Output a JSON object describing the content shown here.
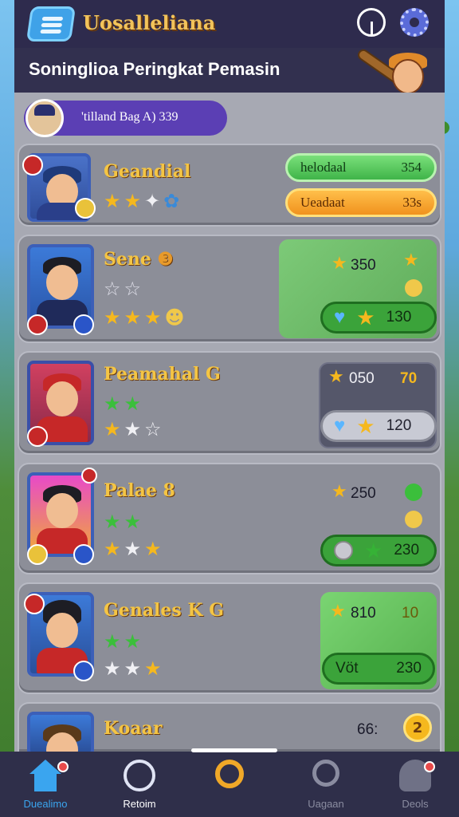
{
  "app": {
    "title": "Uosalleliana"
  },
  "header": {
    "page_title": "Soninglioa Peringkat Pemasin"
  },
  "current_player": {
    "label": "'tilland Bag A) 339"
  },
  "players": [
    {
      "name": "Geandial",
      "pill_primary_label": "helodaal",
      "pill_primary_value": "354",
      "pill_secondary_label": "Ueadaat",
      "pill_secondary_value": "33s"
    },
    {
      "name": "Sene",
      "score_top": "350",
      "stat_value": "130"
    },
    {
      "name": "Peamahal",
      "name_badge": "G",
      "score_top": "050",
      "score_top_alt": "70",
      "stat_value": "120"
    },
    {
      "name": "Palae",
      "name_badge": "8",
      "score_top": "250",
      "stat_value": "230"
    },
    {
      "name": "Genales K",
      "name_badge": "G",
      "score_top": "810",
      "score_top_alt": "10",
      "stat_label": "Vöt",
      "stat_value": "230"
    },
    {
      "name": "Koaar",
      "score_top": "66:",
      "badge_value": "2"
    }
  ],
  "nav": {
    "items": [
      {
        "label": "Duealimo",
        "color": "#3aa5ef"
      },
      {
        "label": "Retoim",
        "color": "#ffffff"
      },
      {
        "label": "",
        "color": "#f0a828"
      },
      {
        "label": "Uagaan",
        "color": "#8a8ca0"
      },
      {
        "label": "Deols",
        "color": "#8a8ca0"
      }
    ]
  }
}
